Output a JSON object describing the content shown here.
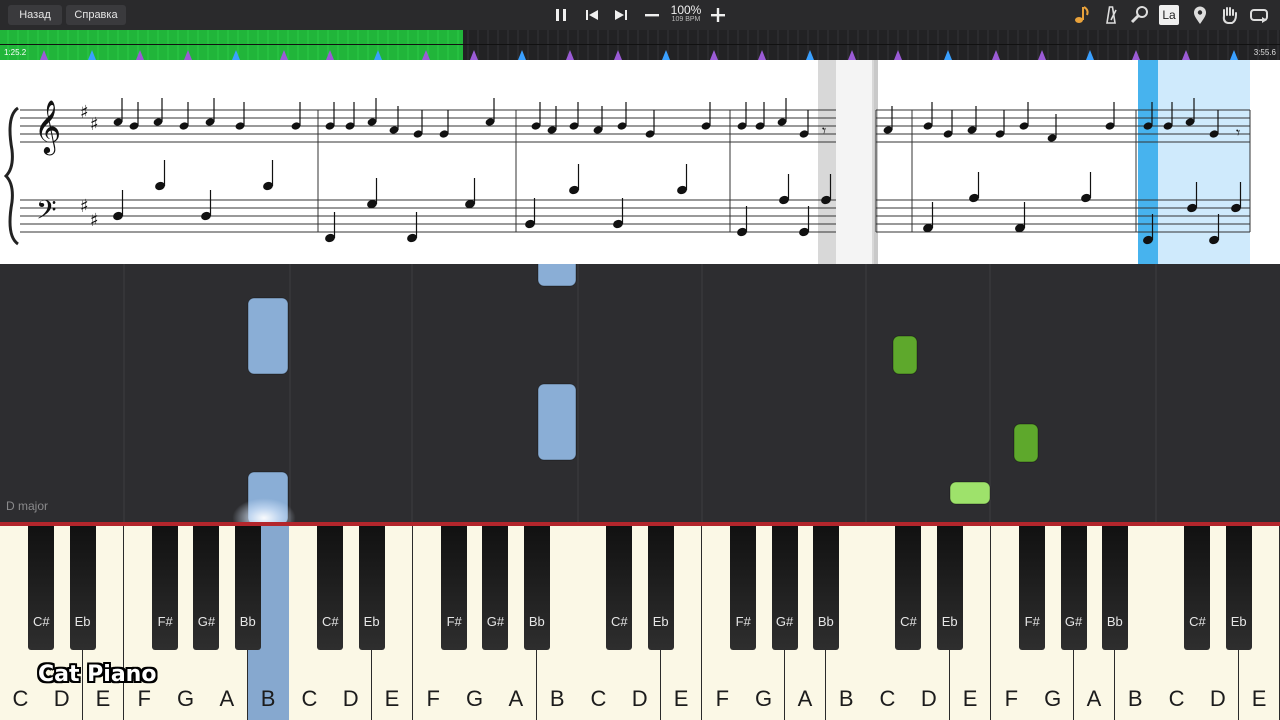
{
  "toolbar": {
    "back_label": "Назад",
    "help_label": "Справка",
    "zoom_percent": "100%",
    "tempo_bpm": "109 BPM",
    "icons": [
      "note-icon",
      "metronome-icon",
      "magnifier-icon",
      "solfege-icon",
      "location-pin-icon",
      "hand-icon",
      "loop-icon"
    ],
    "solfege_label": "La",
    "accent_color": "#e9a23b"
  },
  "timeline": {
    "elapsed": "1:25.2",
    "total": "3:55.6",
    "progress_fraction": 0.362,
    "played_color": "#21b53a"
  },
  "piano_roll": {
    "key_signature": "D major",
    "left_hand_color": "#8aaed6",
    "right_hand_color": "#5ea82c"
  },
  "keyboard": {
    "white_keys": [
      "C",
      "D",
      "E",
      "F",
      "G",
      "A",
      "B",
      "C",
      "D",
      "E",
      "F",
      "G",
      "A",
      "B",
      "C",
      "D",
      "E",
      "F",
      "G",
      "A",
      "B",
      "C",
      "D",
      "E",
      "F",
      "G",
      "A",
      "B",
      "C",
      "D",
      "E"
    ],
    "black_groups": [
      [
        "C#",
        "Eb"
      ],
      [
        "F#",
        "G#",
        "Bb"
      ],
      [
        "C#",
        "Eb"
      ],
      [
        "F#",
        "G#",
        "Bb"
      ],
      [
        "C#",
        "Eb"
      ],
      [
        "F#",
        "G#",
        "Bb"
      ],
      [
        "C#",
        "Eb"
      ],
      [
        "F#",
        "G#",
        "Bb"
      ],
      [
        "C#",
        "Eb"
      ]
    ],
    "active_white_index": 6
  },
  "watermark": "Cat Piano"
}
